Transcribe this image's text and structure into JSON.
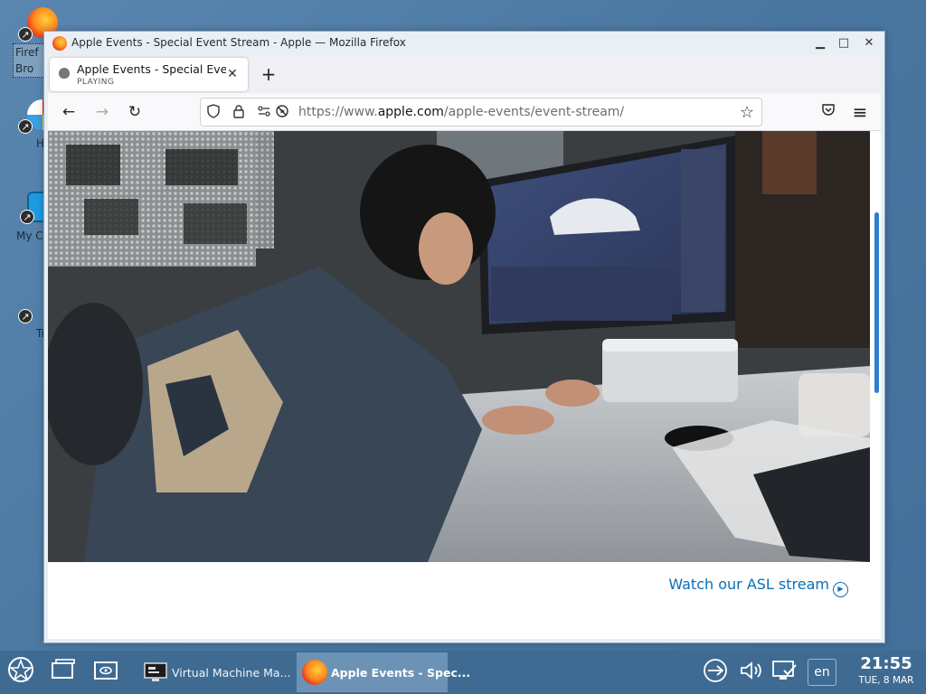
{
  "desktop": {
    "icons": [
      {
        "label": "Firef\nBro",
        "name": "firefox"
      },
      {
        "label": "H",
        "name": "help"
      },
      {
        "label": "My Co",
        "name": "my-computer"
      },
      {
        "label": "Tr",
        "name": "trash"
      }
    ]
  },
  "window": {
    "title": "Apple Events - Special Event Stream - Apple — Mozilla Firefox",
    "minimize": "▁",
    "maximize": "□",
    "close": "✕"
  },
  "tab": {
    "title": "Apple Events - Special Event Stream - Apple",
    "status": "PLAYING",
    "close": "✕",
    "new_tab": "+"
  },
  "nav": {
    "back": "←",
    "forward": "→",
    "reload": "↻",
    "url_prefix": "https://www.",
    "url_domain": "apple.com",
    "url_path": "/apple-events/event-stream/",
    "bookmark": "☆",
    "pocket": "⛉",
    "menu": "≡"
  },
  "page": {
    "asl_link": "Watch our ASL stream"
  },
  "taskbar": {
    "tasks": [
      {
        "label": "Virtual Machine Ma...",
        "active": false
      },
      {
        "label": "Apple Events - Spec...",
        "active": true
      }
    ],
    "language": "en",
    "time": "21:55",
    "date": "TUE, 8 MAR"
  },
  "colors": {
    "desktop": "#4d7aa3",
    "taskbar": "#3f6b93",
    "link": "#0a6fb8",
    "scrollbar": "#2f7fd1"
  }
}
